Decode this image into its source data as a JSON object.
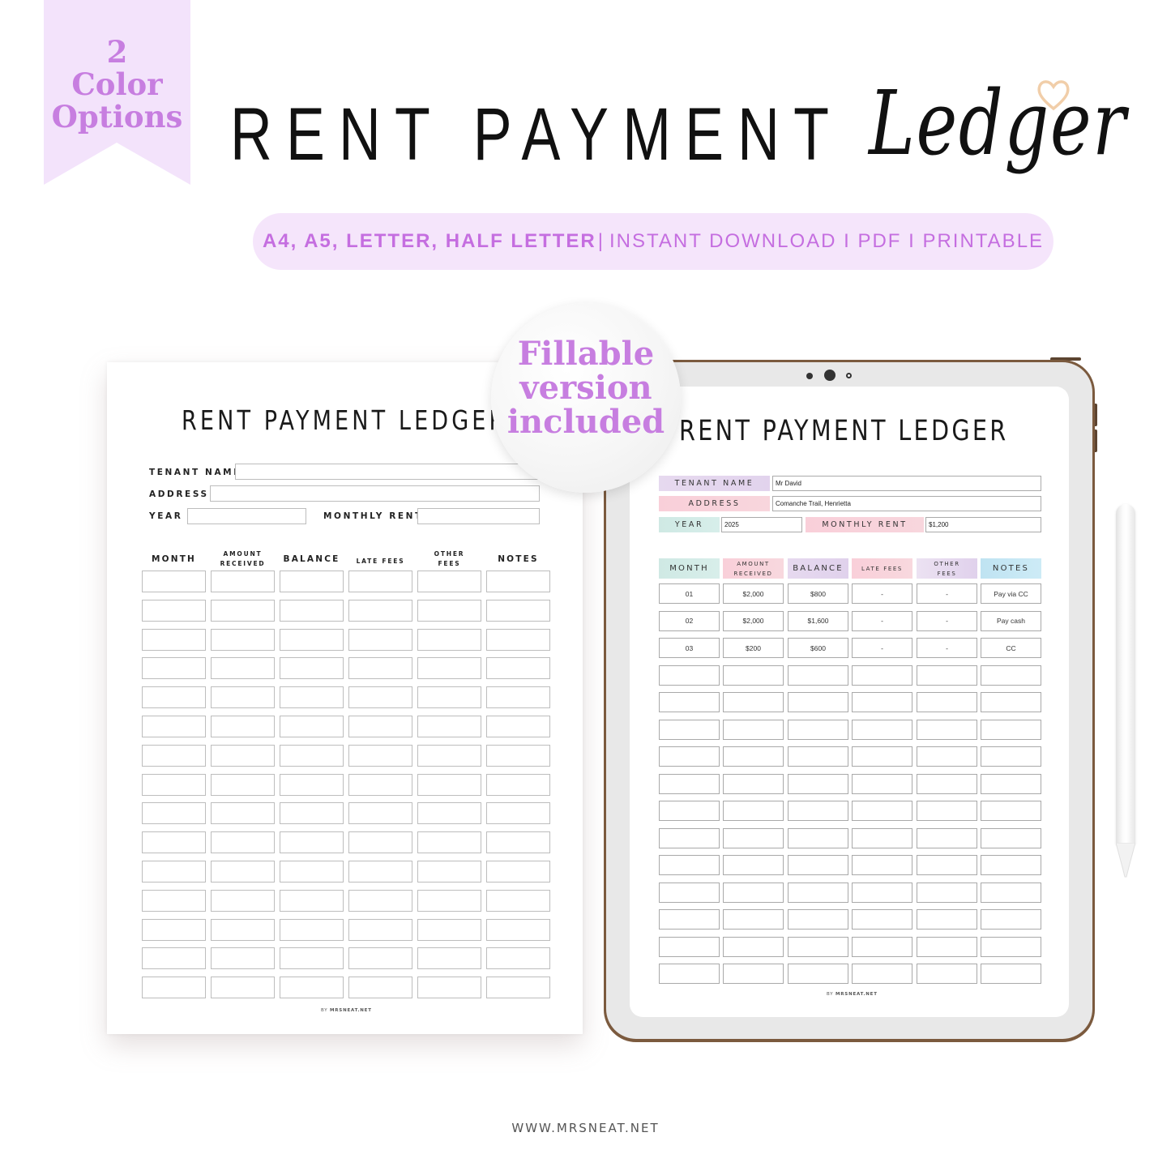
{
  "ribbon": {
    "line1": "2",
    "line2": "Color",
    "line3": "Options"
  },
  "header": {
    "title_caps": "RENT PAYMENT",
    "title_script": "Ledger"
  },
  "formats_pill": {
    "sizes": "A4, A5, LETTER, HALF LETTER",
    "separator": "|",
    "details": "INSTANT DOWNLOAD I PDF I PRINTABLE"
  },
  "sticker": {
    "line1": "Fillable",
    "line2": "version",
    "line3": "included"
  },
  "colors": {
    "accent_purple": "#c77ee0",
    "ribbon_bg": "#f3e3fb",
    "pill_bg": "#f5e5fb",
    "tablet_frame": "#7b5a3e",
    "label_lavender": "#e4d6ee",
    "label_pink": "#f9d1da",
    "label_mint": "#cfe9e4",
    "label_blue": "#bfe5f3"
  },
  "printable_page": {
    "title": "RENT PAYMENT LEDGER",
    "fields": {
      "tenant_name": "TENANT NAME",
      "address": "ADDRESS",
      "year": "YEAR",
      "monthly_rent": "MONTHLY RENT"
    },
    "columns": [
      {
        "line1": "MONTH",
        "line2": ""
      },
      {
        "line1": "AMOUNT",
        "line2": "RECEIVED"
      },
      {
        "line1": "BALANCE",
        "line2": ""
      },
      {
        "line1": "LATE FEES",
        "line2": ""
      },
      {
        "line1": "OTHER",
        "line2": "FEES"
      },
      {
        "line1": "NOTES",
        "line2": ""
      }
    ],
    "row_count": 15,
    "footer_prefix": "BY",
    "footer_site": "MRSNEAT.NET"
  },
  "tablet_page": {
    "title": "RENT PAYMENT LEDGER",
    "fields": {
      "tenant_name": {
        "label": "TENANT NAME",
        "value": "Mr David"
      },
      "address": {
        "label": "ADDRESS",
        "value": "Comanche Trail, Henrietta"
      },
      "year": {
        "label": "YEAR",
        "value": "2025"
      },
      "monthly_rent": {
        "label": "MONTHLY RENT",
        "value": "$1,200"
      }
    },
    "columns": [
      {
        "line1": "MONTH",
        "line2": ""
      },
      {
        "line1": "AMOUNT",
        "line2": "RECEIVED"
      },
      {
        "line1": "BALANCE",
        "line2": ""
      },
      {
        "line1": "LATE FEES",
        "line2": ""
      },
      {
        "line1": "OTHER",
        "line2": "FEES"
      },
      {
        "line1": "NOTES",
        "line2": ""
      }
    ],
    "rows": [
      [
        "01",
        "$2,000",
        "$800",
        "-",
        "-",
        "Pay via CC"
      ],
      [
        "02",
        "$2,000",
        "$1,600",
        "-",
        "-",
        "Pay cash"
      ],
      [
        "03",
        "$200",
        "$600",
        "-",
        "-",
        "CC"
      ],
      [
        "",
        "",
        "",
        "",
        "",
        ""
      ],
      [
        "",
        "",
        "",
        "",
        "",
        ""
      ],
      [
        "",
        "",
        "",
        "",
        "",
        ""
      ],
      [
        "",
        "",
        "",
        "",
        "",
        ""
      ],
      [
        "",
        "",
        "",
        "",
        "",
        ""
      ],
      [
        "",
        "",
        "",
        "",
        "",
        ""
      ],
      [
        "",
        "",
        "",
        "",
        "",
        ""
      ],
      [
        "",
        "",
        "",
        "",
        "",
        ""
      ],
      [
        "",
        "",
        "",
        "",
        "",
        ""
      ],
      [
        "",
        "",
        "",
        "",
        "",
        ""
      ],
      [
        "",
        "",
        "",
        "",
        "",
        ""
      ],
      [
        "",
        "",
        "",
        "",
        "",
        ""
      ]
    ],
    "footer_prefix": "BY",
    "footer_site": "MRSNEAT.NET"
  },
  "footer": {
    "url": "WWW.MRSNEAT.NET"
  }
}
